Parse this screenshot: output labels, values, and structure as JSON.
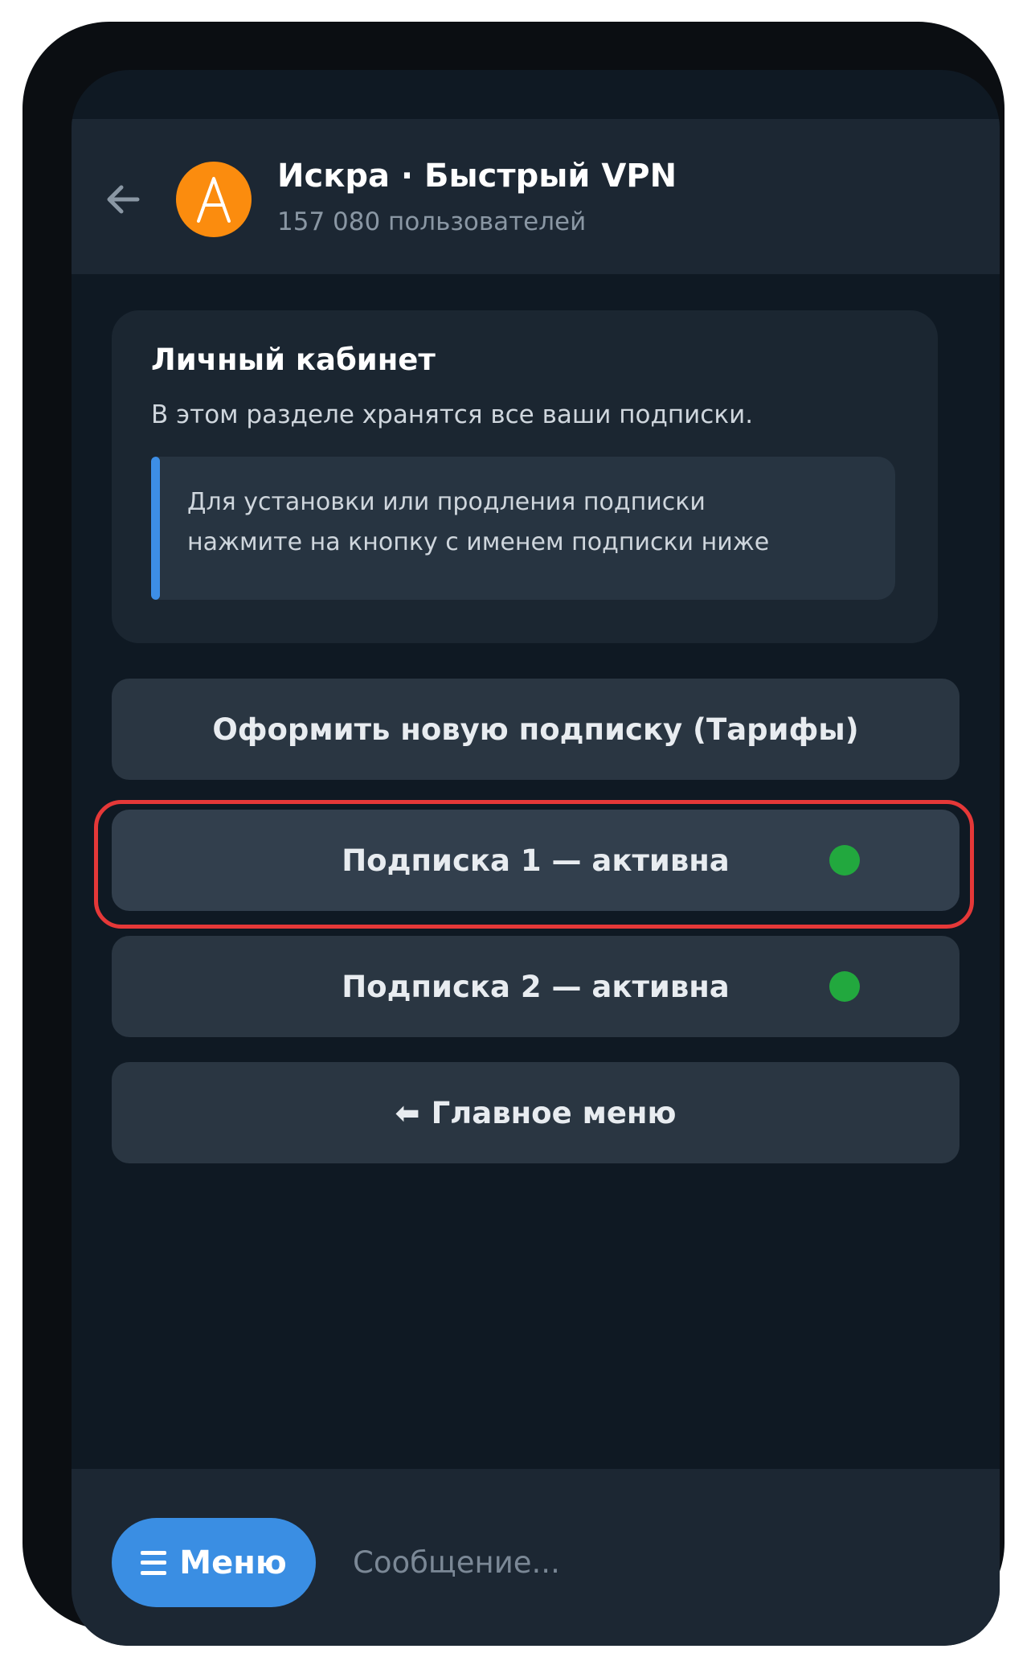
{
  "header": {
    "title": "Искра · Быстрый VPN",
    "subtitle": "157 080 пользователей",
    "avatar_letter": "A"
  },
  "message": {
    "title": "Личный кабинет",
    "description": "В этом разделе хранятся все ваши подписки.",
    "note_line1": "Для установки или продления подписки",
    "note_line2": "нажмите на кнопку с именем подписки ниже"
  },
  "keyboard": {
    "new_subscription": "Оформить новую подписку (Тарифы)",
    "subscription_1": "Подписка 1 — активна",
    "subscription_2": "Подписка 2 — активна",
    "main_menu_arrow": "⬅",
    "main_menu": "Главное меню"
  },
  "composer": {
    "menu_label": "Меню",
    "input_placeholder": "Сообщение..."
  },
  "colors": {
    "accent": "#3a8ee3",
    "status_active": "#22a83e",
    "highlight": "#e53838",
    "avatar": "#fb8c0e"
  }
}
